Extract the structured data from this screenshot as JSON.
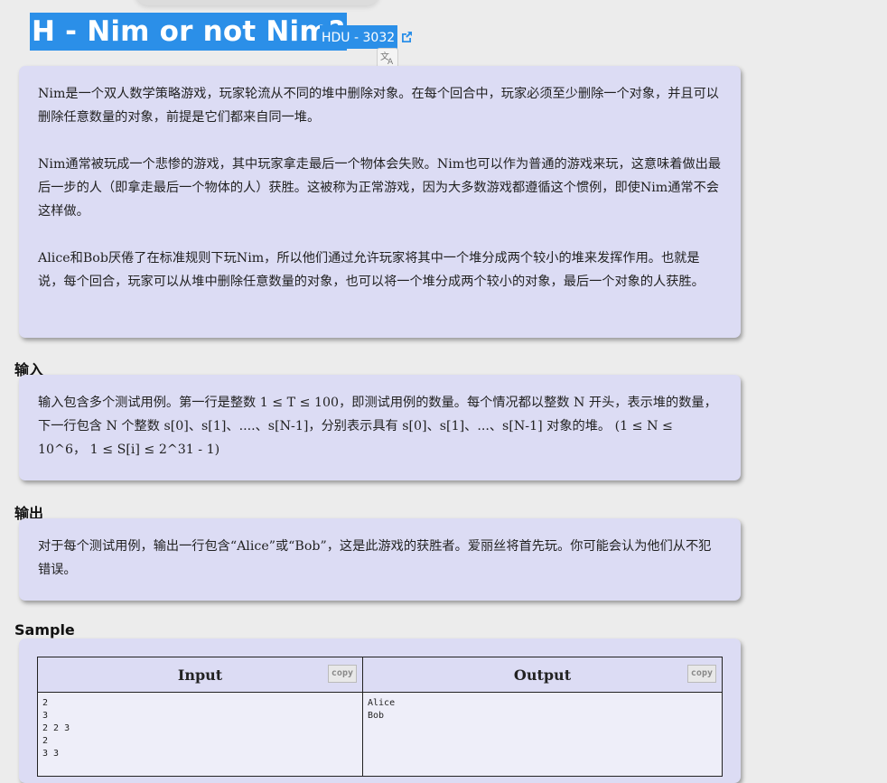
{
  "problem": {
    "title": "H - Nim or not Nim?",
    "source": "HDU - 3032"
  },
  "description": {
    "paragraphs": [
      "Nim是一个双人数学策略游戏，玩家轮流从不同的堆中删除对象。在每个回合中，玩家必须至少删除一个对象，并且可以删除任意数量的对象，前提是它们都来自同一堆。",
      "Nim通常被玩成一个悲惨的游戏，其中玩家拿走最后一个物体会失败。Nim也可以作为普通的游戏来玩，这意味着做出最后一步的人（即拿走最后一个物体的人）获胜。这被称为正常游戏，因为大多数游戏都遵循这个惯例，即使Nim通常不会这样做。",
      "Alice和Bob厌倦了在标准规则下玩Nim，所以他们通过允许玩家将其中一个堆分成两个较小的堆来发挥作用。也就是说，每个回合，玩家可以从堆中删除任意数量的对象，也可以将一个堆分成两个较小的对象，最后一个对象的人获胜。"
    ]
  },
  "input_section": {
    "heading": "输入",
    "text": "输入包含多个测试用例。第一行是整数 1 ≤ T ≤ 100，即测试用例的数量。每个情况都以整数 N 开头，表示堆的数量，下一行包含 N 个整数 s[0]、s[1]、....、s[N-1]，分别表示具有 s[0]、s[1]、...、s[N-1] 对象的堆。 (1 ≤ N ≤ 10^6， 1 ≤ S[i] ≤ 2^31 - 1)"
  },
  "output_section": {
    "heading": "输出",
    "text": "对于每个测试用例，输出一行包含“Alice”或“Bob”，这是此游戏的获胜者。爱丽丝将首先玩。你可能会认为他们从不犯错误。"
  },
  "sample": {
    "heading": "Sample",
    "input_header": "Input",
    "output_header": "Output",
    "copy_label": "copy",
    "input_text": "2\n3\n2 2 3\n2\n3 3",
    "output_text": "Alice\nBob"
  },
  "icons": {
    "external_link": "external-link-icon",
    "translate": "translate-icon"
  },
  "colors": {
    "accent": "#2b8fe8",
    "box_background": "#dcdcf4",
    "page_background": "#ececec"
  }
}
